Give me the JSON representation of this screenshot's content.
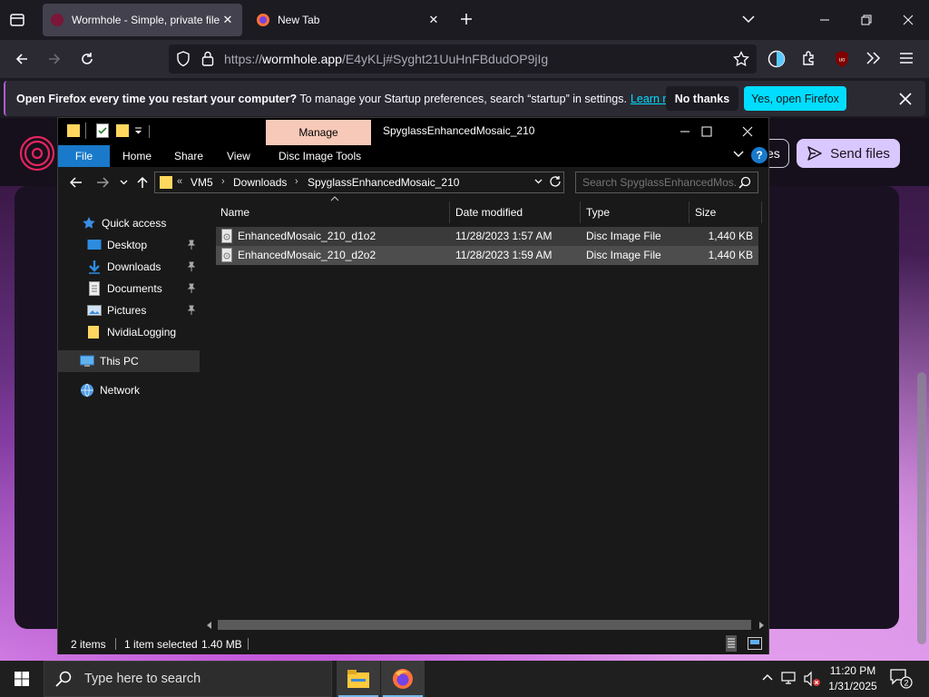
{
  "browser": {
    "tabs": [
      {
        "title": "Wormhole - Simple, private file",
        "active": true
      },
      {
        "title": "New Tab",
        "active": false
      }
    ],
    "url_prefix": "https://",
    "url_host": "wormhole.app",
    "url_rest": "/E4yKLj#Syght21UuHnFBdudOP9jIg"
  },
  "notification": {
    "bold": "Open Firefox every time you restart your computer?",
    "text": " To manage your Startup preferences, search “startup” in settings.",
    "link": "Learn more",
    "no_thanks": "No thanks",
    "open": "Yes, open Firefox"
  },
  "page": {
    "send_files": "Send files",
    "hidden_btn_label": "es"
  },
  "explorer": {
    "title": "SpyglassEnhancedMosaic_210",
    "manage_tab": "Manage",
    "ribbon_tabs": [
      "File",
      "Home",
      "Share",
      "View",
      "Disc Image Tools"
    ],
    "address": {
      "overflow": "«",
      "crumbs": [
        "VM5",
        "Downloads",
        "SpyglassEnhancedMosaic_210"
      ]
    },
    "search_placeholder": "Search SpyglassEnhancedMos...",
    "nav": {
      "quick_access": "Quick access",
      "items": [
        {
          "label": "Desktop",
          "icon": "desktop-icon",
          "pinned": true
        },
        {
          "label": "Downloads",
          "icon": "downloads-icon",
          "pinned": true
        },
        {
          "label": "Documents",
          "icon": "documents-icon",
          "pinned": true
        },
        {
          "label": "Pictures",
          "icon": "pictures-icon",
          "pinned": true
        },
        {
          "label": "NvidiaLogging",
          "icon": "folder-icon",
          "pinned": false
        }
      ],
      "this_pc": "This PC",
      "network": "Network"
    },
    "columns": [
      "Name",
      "Date modified",
      "Type",
      "Size"
    ],
    "files": [
      {
        "name": "EnhancedMosaic_210_d1o2",
        "date": "11/28/2023 1:57 AM",
        "type": "Disc Image File",
        "size": "1,440 KB",
        "state": "hover"
      },
      {
        "name": "EnhancedMosaic_210_d2o2",
        "date": "11/28/2023 1:59 AM",
        "type": "Disc Image File",
        "size": "1,440 KB",
        "state": "selected"
      }
    ],
    "status": {
      "count": "2 items",
      "selected": "1 item selected",
      "size": "1.40 MB"
    }
  },
  "taskbar": {
    "search_placeholder": "Type here to search",
    "time": "11:20 PM",
    "date": "1/31/2025",
    "notifications": "2"
  },
  "colors": {
    "firefox_accent": "#00ddff",
    "explorer_file_tab": "#1979ca",
    "manage_tab": "#f7c9b8",
    "send_files_bg": "#d9c7ff"
  }
}
